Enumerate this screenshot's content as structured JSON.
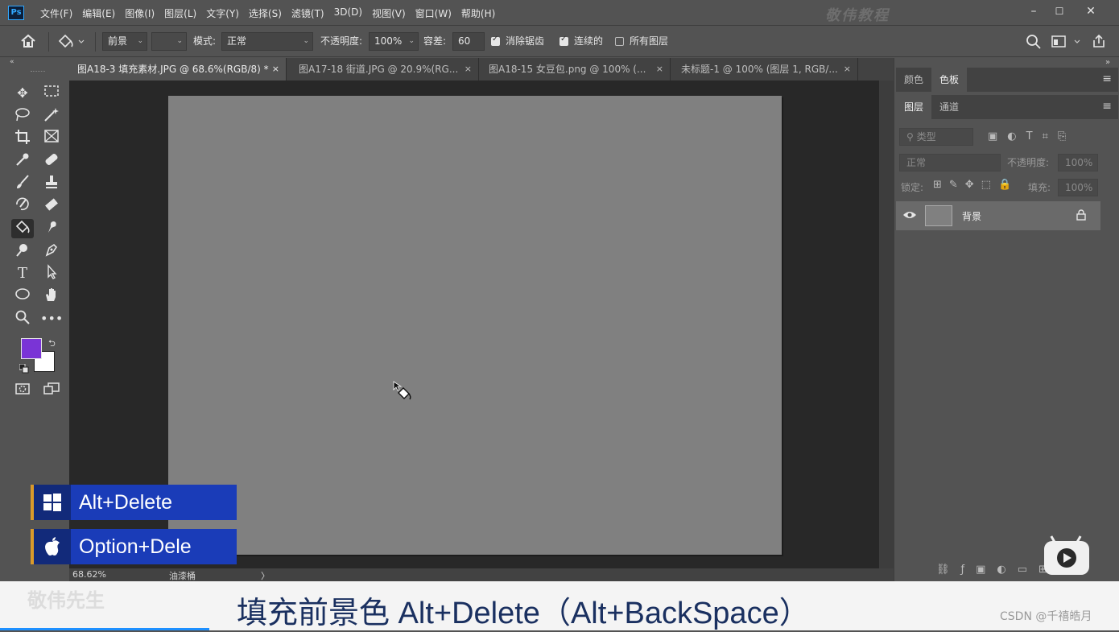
{
  "menubar": {
    "logo": "Ps",
    "items": [
      "文件(F)",
      "编辑(E)",
      "图像(I)",
      "图层(L)",
      "文字(Y)",
      "选择(S)",
      "滤镜(T)",
      "3D(D)",
      "视图(V)",
      "窗口(W)",
      "帮助(H)"
    ],
    "watermark": "敬伟教程",
    "window_controls": [
      "–",
      "☐",
      "✕"
    ]
  },
  "options": {
    "home_icon": "home-icon",
    "fill_source": "前景",
    "mode_label": "模式:",
    "mode_value": "正常",
    "opacity_label": "不透明度:",
    "opacity_value": "100%",
    "tolerance_label": "容差:",
    "tolerance_value": "60",
    "antialias_label": "消除锯齿",
    "antialias_checked": true,
    "contiguous_label": "连续的",
    "contiguous_checked": true,
    "all_layers_label": "所有图层",
    "all_layers_checked": false
  },
  "toolbar": {
    "collapse": "«",
    "foreground_color": "#7a34d6",
    "background_color": "#ffffff"
  },
  "tabs": [
    {
      "label": "图A18-3 填充素材.JPG @ 68.6%(RGB/8) *",
      "close": "×",
      "active": true
    },
    {
      "label": "图A17-18 街道.JPG @ 20.9%(RG...",
      "close": "×",
      "active": false
    },
    {
      "label": "图A18-15 女豆包.png @ 100% (...",
      "close": "×",
      "active": false
    },
    {
      "label": "未标题-1 @ 100% (图层 1, RGB/...",
      "close": "×",
      "active": false
    }
  ],
  "statusbar": {
    "zoom": "68.62%",
    "tool_hint": "油漆桶",
    "arrow": "〉"
  },
  "panels": {
    "expand": "»",
    "top_tabs": [
      "颜色",
      "色板"
    ],
    "layer_tabs": [
      "图层",
      "通道"
    ],
    "filter_placeholder": "类型",
    "blend_mode": "正常",
    "opacity_label": "不透明度:",
    "opacity_value": "100%",
    "lock_label": "锁定:",
    "fill_label": "填充:",
    "fill_value": "100%",
    "layer_name": "背景"
  },
  "overlay": {
    "win_shortcut": "Alt+Delete",
    "mac_shortcut": "Option+Dele",
    "caption": "填充前景色 Alt+Delete（Alt+BackSpace）",
    "brand": "敬伟先生",
    "credit": "CSDN @千禧皓月"
  }
}
